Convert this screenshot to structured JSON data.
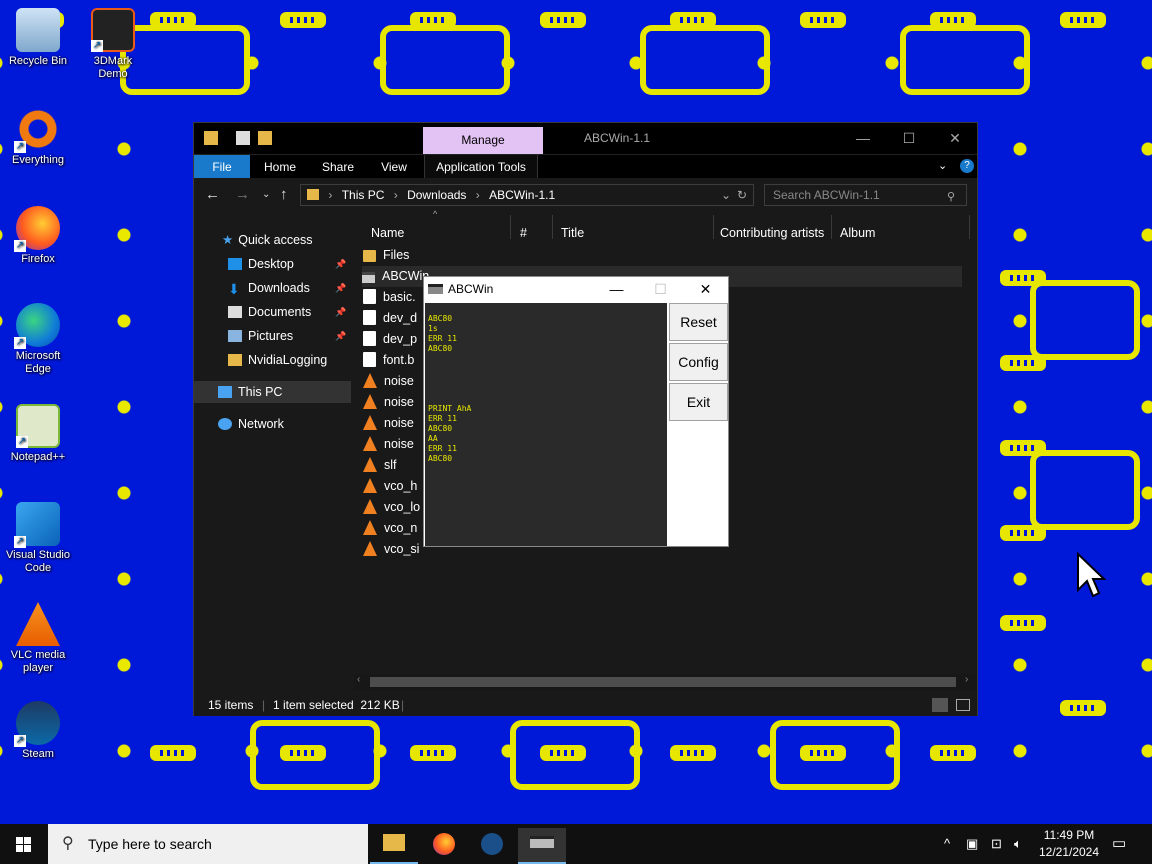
{
  "desktop_icons": [
    {
      "label": "Recycle Bin",
      "icon": "recycle-bin-icon"
    },
    {
      "label": "3DMark Demo",
      "icon": "3dmark-icon"
    },
    {
      "label": "Everything",
      "icon": "everything-icon"
    },
    {
      "label": "Firefox",
      "icon": "firefox-icon"
    },
    {
      "label": "Microsoft Edge",
      "icon": "edge-icon"
    },
    {
      "label": "Notepad++",
      "icon": "notepadpp-icon"
    },
    {
      "label": "Visual Studio Code",
      "icon": "vscode-icon"
    },
    {
      "label": "VLC media player",
      "icon": "vlc-icon"
    },
    {
      "label": "Steam",
      "icon": "steam-icon"
    }
  ],
  "explorer": {
    "manage_tab": "Manage",
    "title": "ABCWin-1.1",
    "ribbon_tabs": [
      "File",
      "Home",
      "Share",
      "View",
      "Application Tools"
    ],
    "breadcrumb": [
      "This PC",
      "Downloads",
      "ABCWin-1.1"
    ],
    "search_placeholder": "Search ABCWin-1.1",
    "nav": {
      "quick_access": "Quick access",
      "items": [
        "Desktop",
        "Downloads",
        "Documents",
        "Pictures",
        "NvidiaLogging"
      ],
      "this_pc": "This PC",
      "network": "Network"
    },
    "columns": [
      "Name",
      "#",
      "Title",
      "Contributing artists",
      "Album"
    ],
    "files": [
      {
        "name": "Files",
        "type": "folder"
      },
      {
        "name": "ABCWin",
        "type": "exe"
      },
      {
        "name": "basic.",
        "type": "doc"
      },
      {
        "name": "dev_d",
        "type": "doc"
      },
      {
        "name": "dev_p",
        "type": "doc"
      },
      {
        "name": "font.b",
        "type": "doc"
      },
      {
        "name": "noise",
        "type": "vlc"
      },
      {
        "name": "noise",
        "type": "vlc"
      },
      {
        "name": "noise",
        "type": "vlc"
      },
      {
        "name": "noise",
        "type": "vlc"
      },
      {
        "name": "slf",
        "type": "vlc"
      },
      {
        "name": "vco_h",
        "type": "vlc"
      },
      {
        "name": "vco_lo",
        "type": "vlc"
      },
      {
        "name": "vco_n",
        "type": "vlc"
      },
      {
        "name": "vco_si",
        "type": "vlc"
      }
    ],
    "status": {
      "count": "15 items",
      "selection": "1 item selected  212 KB"
    }
  },
  "abcwin": {
    "title": "ABCWin",
    "screen_text": "ABC80\n1s\nERR 11\nABC80\n\n\n\n\n\nPRINT AhA\nERR 11\nABC80\nAA\nERR 11\nABC80",
    "buttons": [
      "Reset",
      "Config",
      "Exit"
    ]
  },
  "taskbar": {
    "search_placeholder": "Type here to search",
    "time": "11:49 PM",
    "date": "12/21/2024"
  }
}
